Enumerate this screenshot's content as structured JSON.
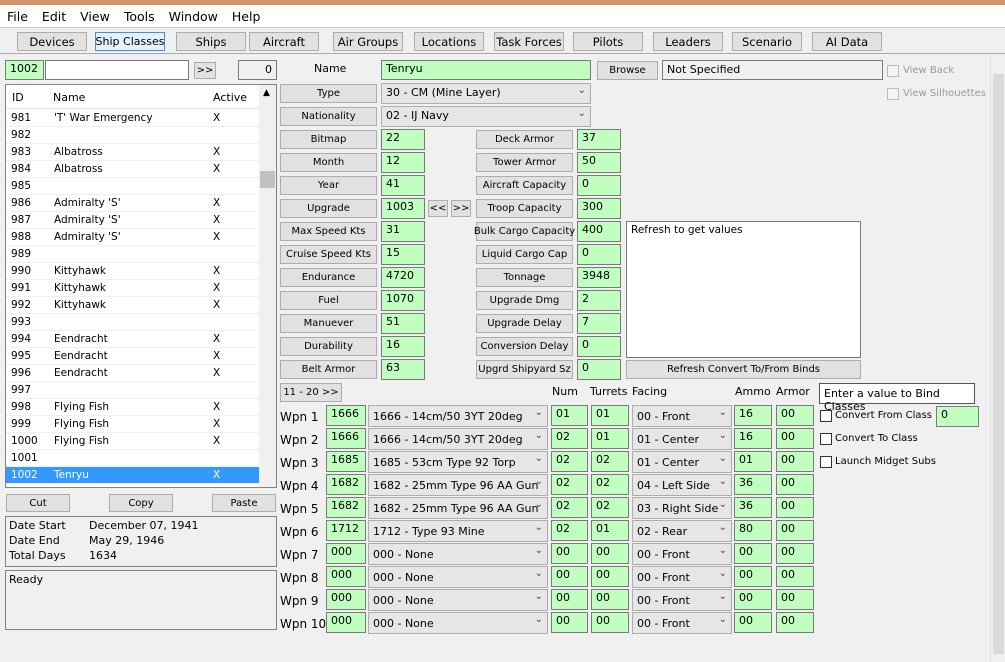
{
  "menu": [
    "File",
    "Edit",
    "View",
    "Tools",
    "Window",
    "Help"
  ],
  "toolbar": [
    {
      "label": "Devices",
      "selected": false
    },
    {
      "label": "Ship Classes",
      "selected": true
    },
    {
      "label": "Ships",
      "selected": false
    },
    {
      "label": "Aircraft",
      "selected": false
    },
    {
      "label": "Air Groups",
      "selected": false
    },
    {
      "label": "Locations",
      "selected": false
    },
    {
      "label": "Task Forces",
      "selected": false
    },
    {
      "label": "Pilots",
      "selected": false
    },
    {
      "label": "Leaders",
      "selected": false
    },
    {
      "label": "Scenario",
      "selected": false
    },
    {
      "label": "AI Data",
      "selected": false
    }
  ],
  "search": {
    "id": "1002",
    "text": "",
    "go": ">>",
    "count": "0"
  },
  "list": {
    "headers": [
      "ID",
      "Name",
      "Active"
    ],
    "rows": [
      [
        "981",
        "'T' War Emergency",
        "X"
      ],
      [
        "982",
        "",
        ""
      ],
      [
        "983",
        "Albatross",
        "X"
      ],
      [
        "984",
        "Albatross",
        "X"
      ],
      [
        "985",
        "",
        ""
      ],
      [
        "986",
        "Admiralty 'S'",
        "X"
      ],
      [
        "987",
        "Admiralty 'S'",
        "X"
      ],
      [
        "988",
        "Admiralty 'S'",
        "X"
      ],
      [
        "989",
        "",
        ""
      ],
      [
        "990",
        "Kittyhawk",
        "X"
      ],
      [
        "991",
        "Kittyhawk",
        "X"
      ],
      [
        "992",
        "Kittyhawk",
        "X"
      ],
      [
        "993",
        "",
        ""
      ],
      [
        "994",
        "Eendracht",
        "X"
      ],
      [
        "995",
        "Eendracht",
        "X"
      ],
      [
        "996",
        "Eendracht",
        "X"
      ],
      [
        "997",
        "",
        ""
      ],
      [
        "998",
        "Flying Fish",
        "X"
      ],
      [
        "999",
        "Flying Fish",
        "X"
      ],
      [
        "1000",
        "Flying Fish",
        "X"
      ],
      [
        "1001",
        "",
        ""
      ],
      [
        "1002",
        "Tenryu",
        "X"
      ]
    ],
    "selected": "1002"
  },
  "edit": {
    "cut": "Cut",
    "copy": "Copy",
    "paste": "Paste"
  },
  "dates": [
    [
      "Date Start",
      "December 07, 1941"
    ],
    [
      "Date End",
      "May 29, 1946"
    ],
    [
      "Total Days",
      "1634"
    ]
  ],
  "status": "Ready",
  "name": {
    "label": "Name",
    "value": "Tenryu",
    "browse": "Browse",
    "bitmap_file": "Not Specified"
  },
  "type": {
    "label": "Type",
    "value": "30 - CM (Mine Layer)"
  },
  "nationality": {
    "label": "Nationality",
    "value": "02 - IJ Navy"
  },
  "left_fields": [
    [
      "Bitmap",
      "22"
    ],
    [
      "Month",
      "12"
    ],
    [
      "Year",
      "41"
    ],
    [
      "Upgrade",
      "1003"
    ],
    [
      "Max Speed Kts",
      "31"
    ],
    [
      "Cruise Speed Kts",
      "15"
    ],
    [
      "Endurance",
      "4720"
    ],
    [
      "Fuel",
      "1070"
    ],
    [
      "Manuever",
      "51"
    ],
    [
      "Durability",
      "16"
    ],
    [
      "Belt Armor",
      "63"
    ]
  ],
  "upgrade_nav": {
    "prev": "<<",
    "next": ">>"
  },
  "right_fields": [
    [
      "Deck Armor",
      "37"
    ],
    [
      "Tower Armor",
      "50"
    ],
    [
      "Aircraft Capacity",
      "0"
    ],
    [
      "Troop Capacity",
      "300"
    ],
    [
      "Bulk Cargo Capacity",
      "400"
    ],
    [
      "Liquid Cargo Cap",
      "0"
    ],
    [
      "Tonnage",
      "3948"
    ],
    [
      "Upgrade Dmg",
      "2"
    ],
    [
      "Upgrade Delay",
      "7"
    ],
    [
      "Conversion Delay",
      "0"
    ],
    [
      "Upgrd Shipyard Sz",
      "0"
    ]
  ],
  "convert_text": "Refresh to get values",
  "refresh_button": "Refresh Convert To/From Binds",
  "view_back": "View Back",
  "view_silhouettes": "View Silhouettes",
  "weapons": {
    "page_button": "11 - 20 >>",
    "headers": {
      "num": "Num",
      "turrets": "Turrets",
      "facing": "Facing",
      "ammo": "Ammo",
      "armor": "Armor"
    },
    "rows": [
      [
        "Wpn 1",
        "1666",
        "1666 - 14cm/50 3YT 20deg",
        "01",
        "01",
        "00 - Front",
        "16",
        "00"
      ],
      [
        "Wpn 2",
        "1666",
        "1666 - 14cm/50 3YT 20deg",
        "02",
        "01",
        "01 - Center",
        "16",
        "00"
      ],
      [
        "Wpn 3",
        "1685",
        "1685 - 53cm Type 92 Torp",
        "02",
        "02",
        "01 - Center",
        "01",
        "00"
      ],
      [
        "Wpn 4",
        "1682",
        "1682 - 25mm Type 96 AA Gun",
        "02",
        "02",
        "04 - Left Side",
        "36",
        "00"
      ],
      [
        "Wpn 5",
        "1682",
        "1682 - 25mm Type 96 AA Gun",
        "02",
        "02",
        "03 - Right Side",
        "36",
        "00"
      ],
      [
        "Wpn 6",
        "1712",
        "1712 - Type 93 Mine",
        "02",
        "01",
        "02 - Rear",
        "80",
        "00"
      ],
      [
        "Wpn 7",
        "000",
        "000 - None",
        "00",
        "00",
        "00 - Front",
        "00",
        "00"
      ],
      [
        "Wpn 8",
        "000",
        "000 - None",
        "00",
        "00",
        "00 - Front",
        "00",
        "00"
      ],
      [
        "Wpn 9",
        "000",
        "000 - None",
        "00",
        "00",
        "00 - Front",
        "00",
        "00"
      ],
      [
        "Wpn 10",
        "000",
        "000 - None",
        "00",
        "00",
        "00 - Front",
        "00",
        "00"
      ]
    ]
  },
  "bind": {
    "title": "Enter a value to Bind Classes",
    "convert_from": "Convert From Class",
    "convert_from_value": "0",
    "convert_to": "Convert To Class",
    "midget": "Launch Midget Subs"
  }
}
